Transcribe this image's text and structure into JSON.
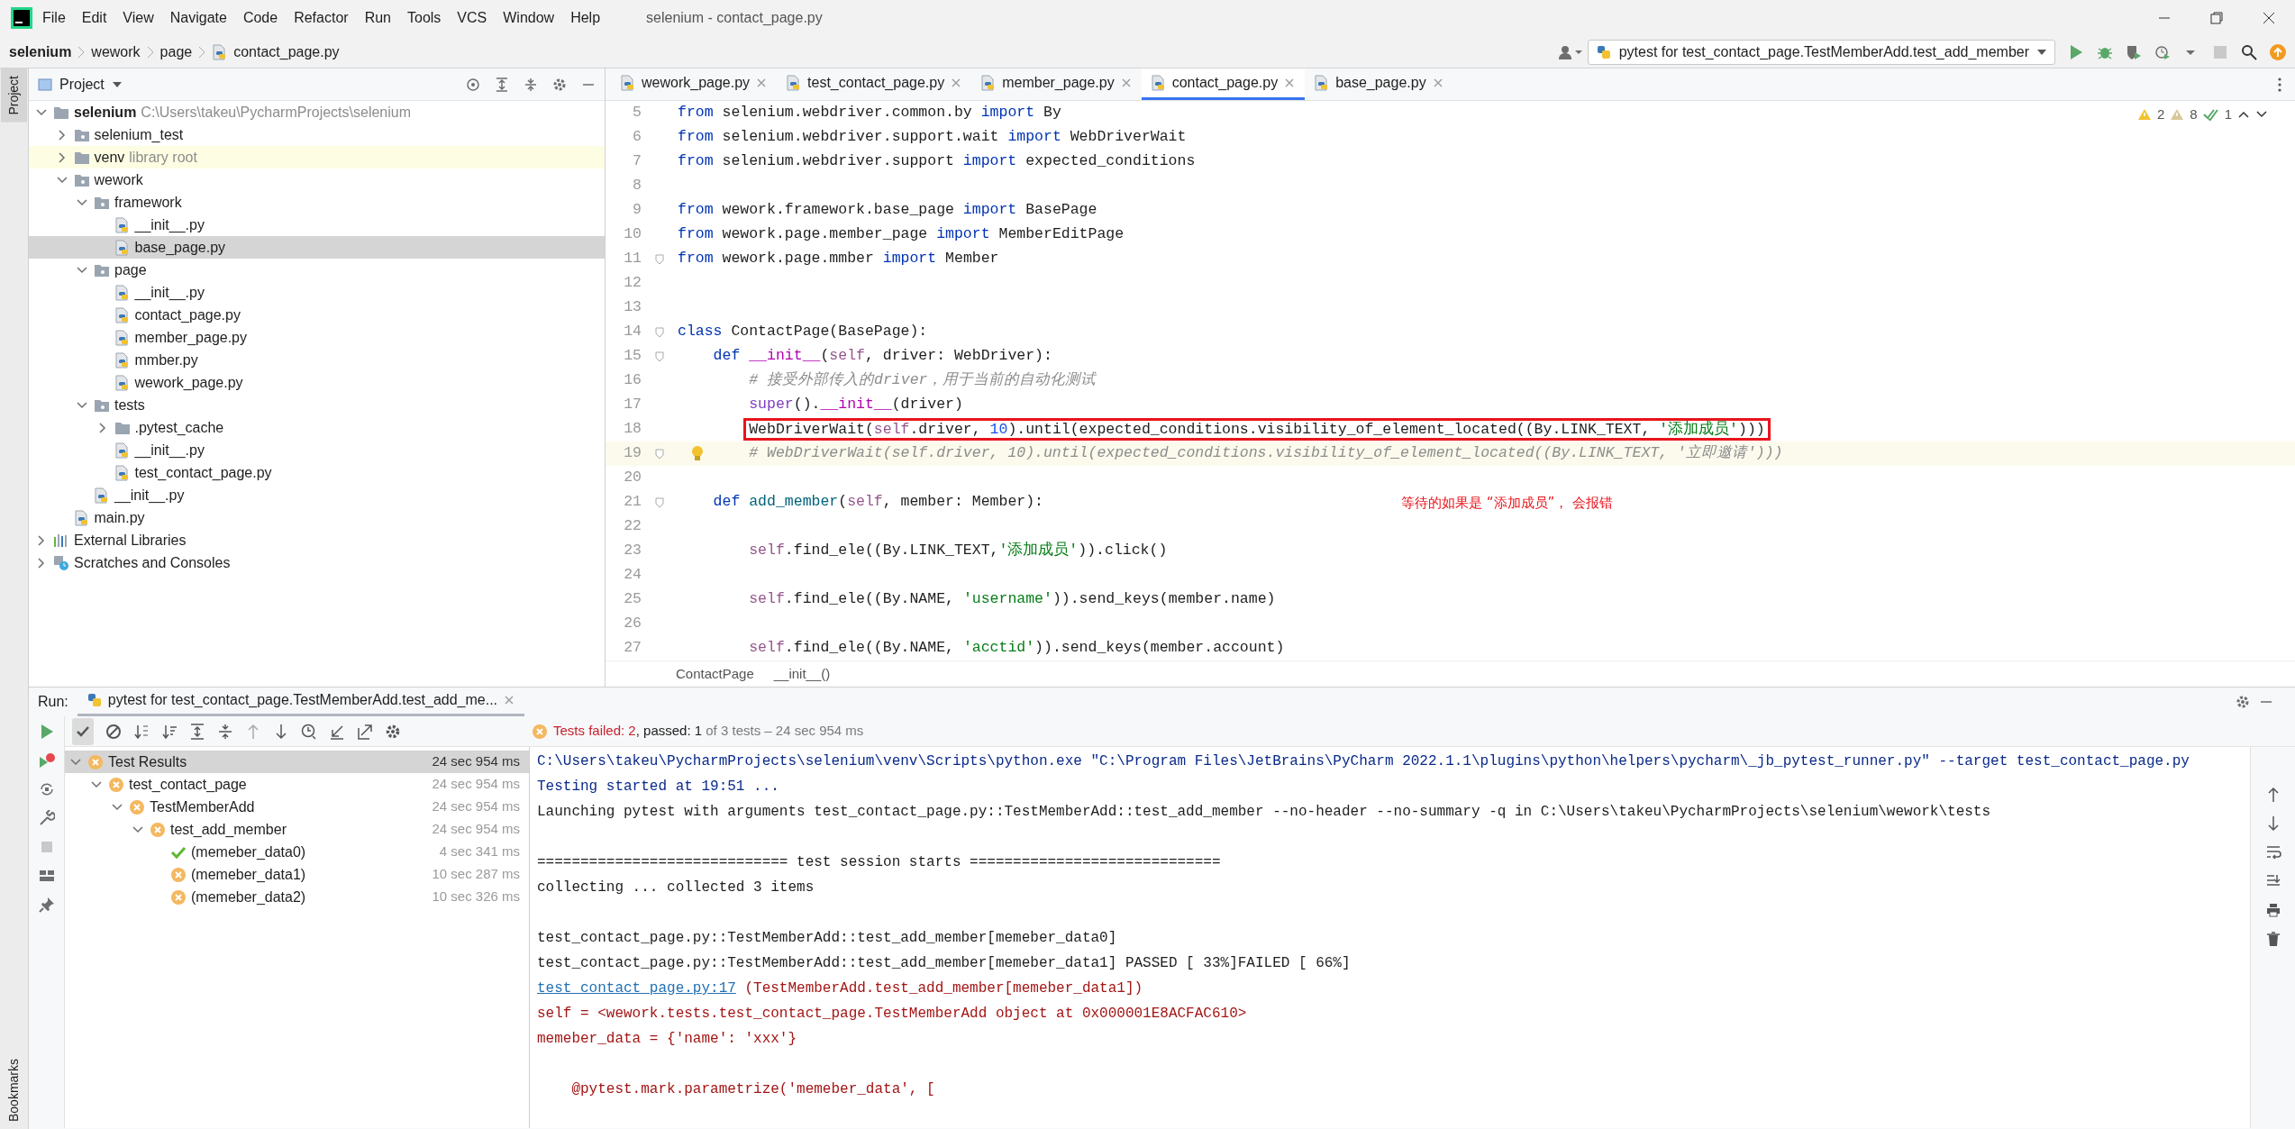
{
  "menu": [
    "File",
    "Edit",
    "View",
    "Navigate",
    "Code",
    "Refactor",
    "Run",
    "Tools",
    "VCS",
    "Window",
    "Help"
  ],
  "window_title": "selenium - contact_page.py",
  "breadcrumb": [
    "selenium",
    "wework",
    "page",
    "contact_page.py"
  ],
  "run_config": "pytest for test_contact_page.TestMemberAdd.test_add_member",
  "project": {
    "title": "Project",
    "tree": [
      {
        "label": "selenium",
        "hint": "C:\\Users\\takeu\\PycharmProjects\\selenium",
        "kind": "root",
        "expanded": true,
        "selected": false,
        "children": [
          {
            "label": "selenium_test",
            "kind": "package",
            "expanded": false,
            "selected": false
          },
          {
            "label": "venv",
            "hint": "library root",
            "kind": "library_folder",
            "expanded": false,
            "selected": false
          },
          {
            "label": "wework",
            "kind": "package",
            "expanded": true,
            "selected": false,
            "children": [
              {
                "label": "framework",
                "kind": "package",
                "expanded": true,
                "selected": false,
                "children": [
                  {
                    "label": "__init__.py",
                    "kind": "file",
                    "selected": false
                  },
                  {
                    "label": "base_page.py",
                    "kind": "file",
                    "selected": true
                  }
                ]
              },
              {
                "label": "page",
                "kind": "package",
                "expanded": true,
                "selected": false,
                "children": [
                  {
                    "label": "__init__.py",
                    "kind": "file",
                    "selected": false
                  },
                  {
                    "label": "contact_page.py",
                    "kind": "file",
                    "selected": false
                  },
                  {
                    "label": "member_page.py",
                    "kind": "file",
                    "selected": false
                  },
                  {
                    "label": "mmber.py",
                    "kind": "file",
                    "selected": false
                  },
                  {
                    "label": "wework_page.py",
                    "kind": "file",
                    "selected": false
                  }
                ]
              },
              {
                "label": "tests",
                "kind": "package",
                "expanded": true,
                "selected": false,
                "children": [
                  {
                    "label": ".pytest_cache",
                    "kind": "folder",
                    "expanded": false,
                    "selected": false
                  },
                  {
                    "label": "__init__.py",
                    "kind": "file",
                    "selected": false
                  },
                  {
                    "label": "test_contact_page.py",
                    "kind": "file",
                    "selected": false
                  }
                ]
              },
              {
                "label": "__init__.py",
                "kind": "file",
                "selected": false
              }
            ]
          },
          {
            "label": "main.py",
            "kind": "file",
            "selected": false
          }
        ]
      },
      {
        "label": "External Libraries",
        "kind": "libraries",
        "expanded": false,
        "selected": false
      },
      {
        "label": "Scratches and Consoles",
        "kind": "scratches",
        "expanded": false,
        "selected": false
      }
    ]
  },
  "editor": {
    "tabs": [
      {
        "label": "wework_page.py",
        "selected": false
      },
      {
        "label": "test_contact_page.py",
        "selected": false
      },
      {
        "label": "member_page.py",
        "selected": false
      },
      {
        "label": "contact_page.py",
        "selected": true
      },
      {
        "label": "base_page.py",
        "selected": false
      }
    ],
    "inspections": {
      "warnings": "2",
      "weak_warnings": "8",
      "passed": "1"
    },
    "lines": [
      {
        "number": "5",
        "fold": false,
        "boxed": false,
        "current": false,
        "tokens": [
          {
            "kind": "keyword",
            "text": "from"
          },
          {
            "kind": "plain",
            "text": " selenium.webdriver.common.by "
          },
          {
            "kind": "keyword",
            "text": "import"
          },
          {
            "kind": "plain",
            "text": " By"
          }
        ]
      },
      {
        "number": "6",
        "fold": false,
        "boxed": false,
        "current": false,
        "tokens": [
          {
            "kind": "keyword",
            "text": "from"
          },
          {
            "kind": "plain",
            "text": " selenium.webdriver.support.wait "
          },
          {
            "kind": "keyword",
            "text": "import"
          },
          {
            "kind": "plain",
            "text": " WebDriverWait"
          }
        ]
      },
      {
        "number": "7",
        "fold": false,
        "boxed": false,
        "current": false,
        "tokens": [
          {
            "kind": "keyword",
            "text": "from"
          },
          {
            "kind": "plain",
            "text": " selenium.webdriver.support "
          },
          {
            "kind": "keyword",
            "text": "import"
          },
          {
            "kind": "plain",
            "text": " expected_conditions"
          }
        ]
      },
      {
        "number": "8",
        "fold": false,
        "boxed": false,
        "current": false
      },
      {
        "number": "9",
        "fold": false,
        "boxed": false,
        "current": false,
        "tokens": [
          {
            "kind": "keyword",
            "text": "from"
          },
          {
            "kind": "plain",
            "text": " wework.framework.base_page "
          },
          {
            "kind": "keyword",
            "text": "import"
          },
          {
            "kind": "plain",
            "text": " BasePage"
          }
        ]
      },
      {
        "number": "10",
        "fold": false,
        "boxed": false,
        "current": false,
        "tokens": [
          {
            "kind": "keyword",
            "text": "from"
          },
          {
            "kind": "plain",
            "text": " wework.page.member_page "
          },
          {
            "kind": "keyword",
            "text": "import"
          },
          {
            "kind": "plain",
            "text": " MemberEditPage"
          }
        ]
      },
      {
        "number": "11",
        "fold": true,
        "boxed": false,
        "current": false,
        "tokens": [
          {
            "kind": "keyword",
            "text": "from"
          },
          {
            "kind": "plain",
            "text": " wework.page.mmber "
          },
          {
            "kind": "keyword",
            "text": "import"
          },
          {
            "kind": "plain",
            "text": " Member"
          }
        ]
      },
      {
        "number": "12",
        "fold": false,
        "boxed": false,
        "current": false
      },
      {
        "number": "13",
        "fold": false,
        "boxed": false,
        "current": false
      },
      {
        "number": "14",
        "fold": true,
        "boxed": false,
        "current": false,
        "tokens": [
          {
            "kind": "keyword",
            "text": "class"
          },
          {
            "kind": "plain",
            "text": " ContactPage(BasePage):"
          }
        ]
      },
      {
        "number": "15",
        "fold": true,
        "boxed": false,
        "current": false,
        "tokens": [
          {
            "kind": "keyword",
            "text": "    def "
          },
          {
            "kind": "magic",
            "text": "__init__"
          },
          {
            "kind": "plain",
            "text": "("
          },
          {
            "kind": "self",
            "text": "self"
          },
          {
            "kind": "plain",
            "text": ", driver: WebDriver):"
          }
        ]
      },
      {
        "number": "16",
        "fold": false,
        "boxed": false,
        "current": false,
        "tokens": [
          {
            "kind": "comment",
            "text": "        # 接受外部传入的driver，用于当前的自动化测试"
          }
        ]
      },
      {
        "number": "17",
        "fold": false,
        "boxed": false,
        "current": false,
        "tokens": [
          {
            "kind": "builtin",
            "text": "        super"
          },
          {
            "kind": "plain",
            "text": "()."
          },
          {
            "kind": "magic",
            "text": "__init__"
          },
          {
            "kind": "plain",
            "text": "(driver)"
          }
        ]
      },
      {
        "number": "18",
        "fold": false,
        "boxed": true,
        "current": false,
        "tokens": [
          {
            "kind": "plain",
            "text": "        WebDriverWait("
          },
          {
            "kind": "self",
            "text": "self"
          },
          {
            "kind": "plain",
            "text": ".driver, "
          },
          {
            "kind": "number",
            "text": "10"
          },
          {
            "kind": "plain",
            "text": ").until(expected_conditions.visibility_of_element_located((By.LINK_TEXT, "
          },
          {
            "kind": "string",
            "text": "'添加成员'"
          },
          {
            "kind": "plain",
            "text": ")))"
          }
        ]
      },
      {
        "number": "19",
        "fold": true,
        "boxed": false,
        "current": true,
        "tokens": [
          {
            "kind": "comment",
            "text": "        # WebDriverWait(self.driver, 10).until(expected_conditions.visibility_of_element_located((By.LINK_TEXT, '立即邀请')))"
          }
        ]
      },
      {
        "number": "20",
        "fold": false,
        "boxed": false,
        "current": false
      },
      {
        "number": "21",
        "fold": true,
        "boxed": false,
        "current": false,
        "tokens": [
          {
            "kind": "keyword",
            "text": "    def "
          },
          {
            "kind": "function",
            "text": "add_member"
          },
          {
            "kind": "plain",
            "text": "("
          },
          {
            "kind": "self",
            "text": "self"
          },
          {
            "kind": "plain",
            "text": ", member: Member):"
          }
        ]
      },
      {
        "number": "22",
        "fold": false,
        "boxed": false,
        "current": false
      },
      {
        "number": "23",
        "fold": false,
        "boxed": false,
        "current": false,
        "tokens": [
          {
            "kind": "self",
            "text": "        self"
          },
          {
            "kind": "plain",
            "text": ".find_ele((By.LINK_TEXT,"
          },
          {
            "kind": "string",
            "text": "'添加成员'"
          },
          {
            "kind": "plain",
            "text": ")).click()"
          }
        ]
      },
      {
        "number": "24",
        "fold": false,
        "boxed": false,
        "current": false
      },
      {
        "number": "25",
        "fold": false,
        "boxed": false,
        "current": false,
        "tokens": [
          {
            "kind": "self",
            "text": "        self"
          },
          {
            "kind": "plain",
            "text": ".find_ele((By.NAME, "
          },
          {
            "kind": "string",
            "text": "'username'"
          },
          {
            "kind": "plain",
            "text": ")).send_keys(member.name)"
          }
        ]
      },
      {
        "number": "26",
        "fold": false,
        "boxed": false,
        "current": false
      },
      {
        "number": "27",
        "fold": false,
        "boxed": false,
        "current": false,
        "tokens": [
          {
            "kind": "self",
            "text": "        self"
          },
          {
            "kind": "plain",
            "text": ".find_ele((By.NAME, "
          },
          {
            "kind": "string",
            "text": "'acctid'"
          },
          {
            "kind": "plain",
            "text": ")).send_keys(member.account)"
          }
        ]
      }
    ],
    "annotation": "等待的如果是 “添加成员”， 会报错",
    "breadcrumb": [
      "ContactPage",
      "__init__()"
    ]
  },
  "run": {
    "label": "Run:",
    "tab": "pytest for test_contact_page.TestMemberAdd.test_add_me...",
    "status": {
      "failed": "Tests failed: 2",
      "passed": ", passed: 1",
      "summary": " of 3 tests – 24 sec 954 ms"
    },
    "results": [
      {
        "label": "Test Results",
        "passed": false,
        "time": "24 sec 954 ms",
        "expanded": true,
        "selected": true,
        "children": [
          {
            "label": "test_contact_page",
            "passed": false,
            "time": "24 sec 954 ms",
            "expanded": true,
            "selected": false,
            "children": [
              {
                "label": "TestMemberAdd",
                "passed": false,
                "time": "24 sec 954 ms",
                "expanded": true,
                "selected": false,
                "children": [
                  {
                    "label": "test_add_member",
                    "passed": false,
                    "time": "24 sec 954 ms",
                    "expanded": true,
                    "selected": false,
                    "children": [
                      {
                        "label": "(memeber_data0)",
                        "passed": true,
                        "time": "4 sec 341 ms",
                        "selected": false
                      },
                      {
                        "label": "(memeber_data1)",
                        "passed": false,
                        "time": "10 sec 287 ms",
                        "selected": false
                      },
                      {
                        "label": "(memeber_data2)",
                        "passed": false,
                        "time": "10 sec 326 ms",
                        "selected": false
                      }
                    ]
                  }
                ]
              }
            ]
          }
        ]
      }
    ],
    "console": [
      {
        "kind": "command",
        "gap_before": false,
        "text": "C:\\Users\\takeu\\PycharmProjects\\selenium\\venv\\Scripts\\python.exe \"C:\\Program Files\\JetBrains\\PyCharm 2022.1.1\\plugins\\python\\helpers\\pycharm\\_jb_pytest_runner.py\" --target test_contact_page.py"
      },
      {
        "kind": "command",
        "gap_before": false,
        "text": "Testing started at 19:51 ..."
      },
      {
        "kind": "output",
        "gap_before": false,
        "text": "Launching pytest with arguments test_contact_page.py::TestMemberAdd::test_add_member --no-header --no-summary -q in C:\\Users\\takeu\\PycharmProjects\\selenium\\wework\\tests"
      },
      {
        "kind": "output",
        "gap_before": true,
        "text": "============================= test session starts ============================="
      },
      {
        "kind": "output",
        "gap_before": false,
        "text": "collecting ... collected 3 items"
      },
      {
        "kind": "output",
        "gap_before": true,
        "text": "test_contact_page.py::TestMemberAdd::test_add_member[memeber_data0]"
      },
      {
        "kind": "output",
        "gap_before": false,
        "text": "test_contact_page.py::TestMemberAdd::test_add_member[memeber_data1] PASSED [ 33%]FAILED [ 66%]"
      },
      {
        "kind": "error_location",
        "gap_before": false,
        "link": "test_contact_page.py:17",
        "text": " (TestMemberAdd.test_add_member[memeber_data1])"
      },
      {
        "kind": "error",
        "gap_before": false,
        "text": "self = <wework.tests.test_contact_page.TestMemberAdd object at 0x000001E8ACFAC610>"
      },
      {
        "kind": "error",
        "gap_before": false,
        "text": "memeber_data = {'name': 'xxx'}"
      },
      {
        "kind": "error",
        "gap_before": true,
        "text": "    @pytest.mark.parametrize('memeber_data', ["
      }
    ]
  },
  "stripe": {
    "top": "Project",
    "bottom": "Bookmarks"
  }
}
